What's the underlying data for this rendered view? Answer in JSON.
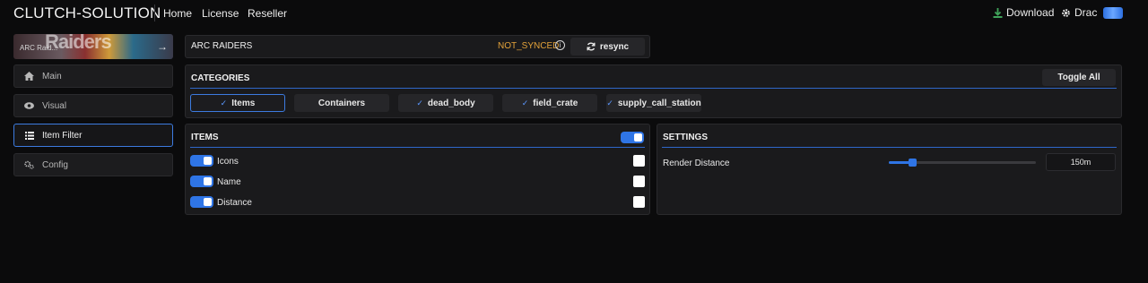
{
  "nav": {
    "brand": "CLUTCH-SOLUTION",
    "links": [
      "Home",
      "License",
      "Reseller"
    ],
    "download": "Download",
    "user": "Drac",
    "download_icon": "download-icon",
    "user_icon": "gear-icon"
  },
  "sidebar": {
    "banner_label": "ARC Raid...",
    "banner_art": "Raiders",
    "items": [
      {
        "label": "Main",
        "icon": "home-icon"
      },
      {
        "label": "Visual",
        "icon": "eye-icon"
      },
      {
        "label": "Item Filter",
        "icon": "list-icon",
        "active": true
      },
      {
        "label": "Config",
        "icon": "gears-icon"
      }
    ]
  },
  "game": {
    "title": "ARC RAIDERS",
    "status": "NOT_SYNCED",
    "resync_label": "resync"
  },
  "categories": {
    "title": "CATEGORIES",
    "toggle_all_label": "Toggle All",
    "chips": [
      {
        "label": "Items",
        "checked": true,
        "selected": true
      },
      {
        "label": "Containers",
        "checked": false,
        "selected": false
      },
      {
        "label": "dead_body",
        "checked": true,
        "selected": false
      },
      {
        "label": "field_crate",
        "checked": true,
        "selected": false
      },
      {
        "label": "supply_call_station",
        "checked": true,
        "selected": false
      }
    ]
  },
  "items_panel": {
    "title": "ITEMS",
    "master_enabled": true,
    "rows": [
      {
        "label": "Icons",
        "enabled": true
      },
      {
        "label": "Name",
        "enabled": true
      },
      {
        "label": "Distance",
        "enabled": true
      }
    ]
  },
  "settings": {
    "title": "SETTINGS",
    "render_distance_label": "Render Distance",
    "render_distance_value": "150m",
    "render_distance_fraction": 0.16
  },
  "colors": {
    "accent": "#2f75e6",
    "warning": "#e3a23a",
    "background": "#0b0b0c",
    "panel": "#1a1a1c"
  }
}
